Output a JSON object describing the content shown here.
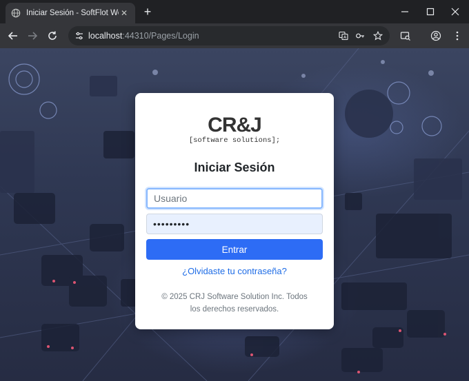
{
  "browser": {
    "tab_title": "Iniciar Sesión - SoftFlot Web",
    "tab_close": "✕",
    "new_tab": "+",
    "url_host": "localhost",
    "url_port_path": ":44310/Pages/Login"
  },
  "login": {
    "logo": "CR&J",
    "logo_subtitle": "[software solutions];",
    "heading": "Iniciar Sesión",
    "username_placeholder": "Usuario",
    "password_masked": "•••••••••",
    "submit_label": "Entrar",
    "forgot_label": "¿Olvidaste tu contraseña?",
    "copyright": "© 2025 CRJ Software Solution Inc. Todos los derechos reservados."
  },
  "colors": {
    "primary_button": "#2d6cf5",
    "link": "#1e6ce6",
    "browser_frame": "#202124"
  }
}
